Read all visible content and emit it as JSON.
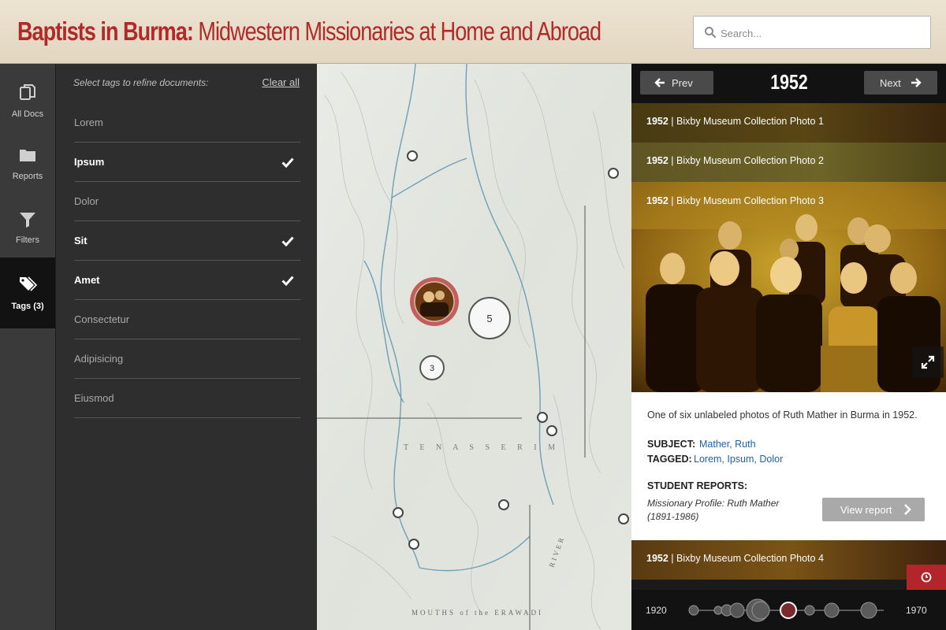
{
  "header": {
    "title_strong": "Baptists in Burma:",
    "title_rest": " Midwestern Missionaries at Home and Abroad",
    "search_placeholder": "Search..."
  },
  "nav": {
    "items": [
      {
        "label": "All Docs",
        "icon": "documents-icon"
      },
      {
        "label": "Reports",
        "icon": "folder-icon"
      },
      {
        "label": "Filters",
        "icon": "filter-icon"
      },
      {
        "label": "Tags (3)",
        "icon": "tags-icon",
        "active": true
      }
    ]
  },
  "tags": {
    "hint": "Select tags to refine documents:",
    "clear_label": "Clear all",
    "items": [
      {
        "label": "Lorem",
        "selected": false
      },
      {
        "label": "Ipsum",
        "selected": true
      },
      {
        "label": "Dolor",
        "selected": false
      },
      {
        "label": "Sit",
        "selected": true
      },
      {
        "label": "Amet",
        "selected": true
      },
      {
        "label": "Consectetur",
        "selected": false
      },
      {
        "label": "Adipisicing",
        "selected": false
      },
      {
        "label": "Eiusmod",
        "selected": false
      }
    ]
  },
  "map": {
    "cluster_large_count": "5",
    "cluster_small_count": "3"
  },
  "docs": {
    "prev_label": "Prev",
    "next_label": "Next",
    "year": "1952",
    "items": [
      {
        "year": "1952",
        "title": "Bixby Museum Collection Photo 1"
      },
      {
        "year": "1952",
        "title": "Bixby Museum Collection Photo 2"
      },
      {
        "year": "1952",
        "title": "Bixby Museum Collection Photo 3"
      },
      {
        "year": "1952",
        "title": "Bixby Museum Collection Photo 4"
      }
    ],
    "separator": " | ",
    "selected": {
      "description": "One of six unlabeled photos of Ruth Mather in Burma in 1952.",
      "subject_label": "SUBJECT:",
      "subject_value": "Mather, Ruth",
      "tagged_label": "TAGGED:",
      "tagged_value": "Lorem, Ipsum, Dolor",
      "reports_label": "STUDENT REPORTS:",
      "report_title": "Missionary Profile: Ruth Mather (1891-1986)",
      "view_report_label": "View report"
    }
  },
  "timeline": {
    "start": "1920",
    "end": "1970"
  },
  "colors": {
    "brand": "#b02a2a",
    "link": "#1f61a8",
    "alert": "#b3252b"
  }
}
